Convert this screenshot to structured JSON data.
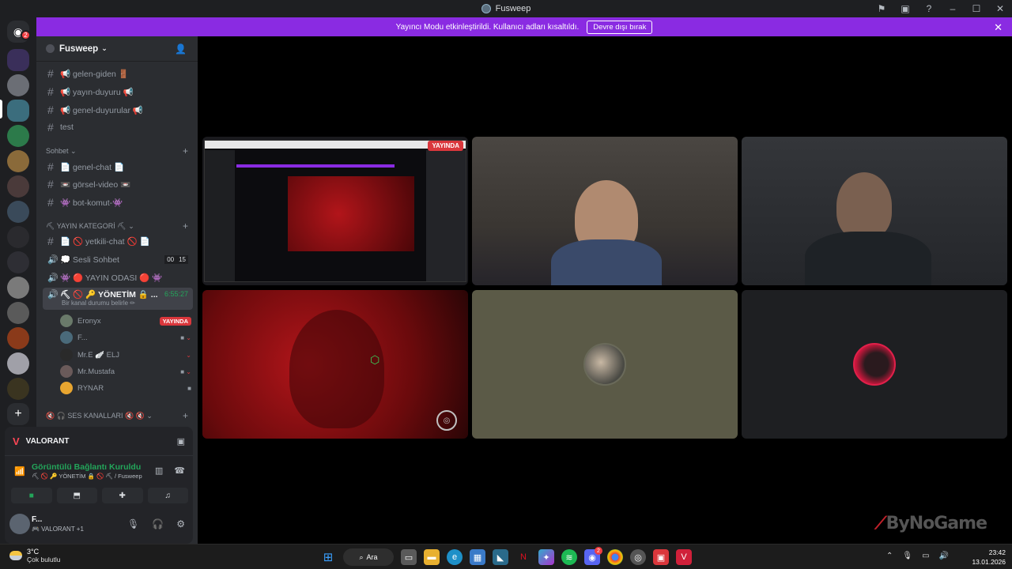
{
  "window": {
    "title": "Fusweep"
  },
  "banner": {
    "message": "Yayıncı Modu etkinleştirildi. Kullanıcı adları kısaltıldı.",
    "button": "Devre dışı bırak"
  },
  "rail": {
    "badge_count": "2"
  },
  "server": {
    "name": "Fusweep"
  },
  "channels": {
    "top": [
      {
        "label": "📢 gelen-giden 🚪"
      },
      {
        "label": "📢 yayın-duyuru 📢"
      },
      {
        "label": "📢 genel-duyurular 📢"
      },
      {
        "label": "test"
      }
    ],
    "category_sohbet": "Sohbet",
    "sohbet": [
      {
        "label": "📄 genel-chat 📄"
      },
      {
        "label": "📼 görsel-video 📼"
      },
      {
        "label": "👾 bot-komut-👾"
      }
    ],
    "category_yayin": "⛏ YAYIN KATEGORİ ⛏",
    "yayin": [
      {
        "label": "📄 🚫 yetkili-chat 🚫 📄",
        "type": "text"
      },
      {
        "label": "💭 Sesli Sohbet",
        "type": "voice",
        "count_a": "00",
        "count_b": "15"
      },
      {
        "label": "👾 🔴 YAYIN ODASI 🔴 👾",
        "type": "voice"
      }
    ],
    "active": {
      "label": "⛏ 🚫 🔑 YÖNETİM 🔒 ...",
      "subtitle": "Bir kanal durumu belirle ✏",
      "timer": "6:55:27"
    },
    "voice_users": [
      {
        "name": "Eronyx",
        "live": "YAYINDA"
      },
      {
        "name": "F..."
      },
      {
        "name": "Mr.E 🪽 ELJ"
      },
      {
        "name": "Mr.Mustafa"
      },
      {
        "name": "RYNAR"
      }
    ],
    "category_ses": "🔇 🎧 SES KANALLARI 🔇 🔇"
  },
  "game_panel": {
    "game": "VALORANT"
  },
  "voice_panel": {
    "status": "Görüntülü Bağlantı Kuruldu",
    "channel": "⛏ 🚫 🔑 YÖNETİM 🔒 🚫 ⛏ / Fusweep"
  },
  "user_panel": {
    "name": "F...",
    "status": "🎮 VALORANT +1"
  },
  "video_grid": {
    "live_tag": "YAYINDA"
  },
  "watermark": {
    "text": "ByNoGame"
  },
  "taskbar": {
    "temp": "3°C",
    "weather": "Çok bulutlu",
    "search_label": "Ara",
    "discord_badge": "2",
    "time": "23:42",
    "date": "13.01.2026"
  },
  "colors": {
    "accent_purple": "#8a2be2",
    "live_red": "#da373c",
    "online_green": "#23a55a"
  }
}
